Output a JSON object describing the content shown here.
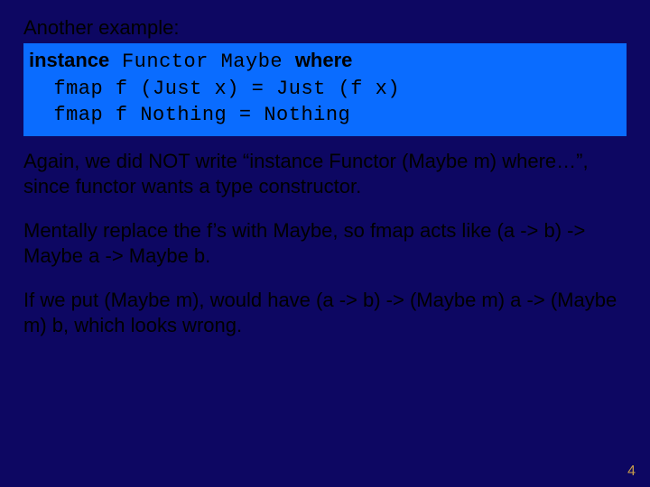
{
  "intro": "Another example:",
  "code": {
    "kw_instance": "instance",
    "functor_maybe": " Functor Maybe ",
    "kw_where": "where",
    "line2": "  fmap f (Just x) = Just (f x)",
    "line3": "  fmap f Nothing = Nothing"
  },
  "para1": "Again, we did NOT write “instance Functor (Maybe m) where…”, since functor wants a type constructor.",
  "para2": "Mentally replace the f’s with Maybe, so fmap acts like (a -> b) -> Maybe a -> Maybe b.",
  "para3": "If we put (Maybe m), would have (a -> b) -> (Maybe m) a -> (Maybe m) b, which looks wrong.",
  "page_number": "4"
}
